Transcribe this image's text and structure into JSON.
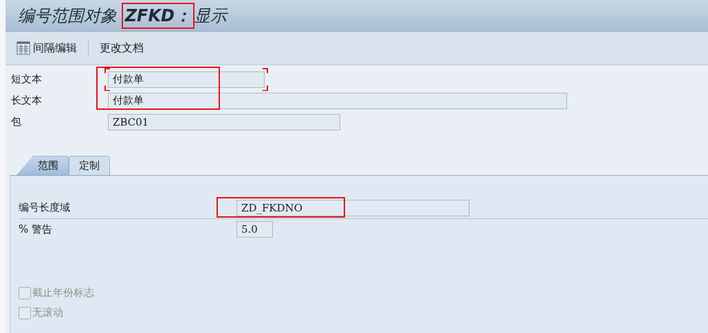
{
  "title": {
    "text": "编号范围对象 **ZFKD：**显示",
    "highlighted": true
  },
  "toolbar": [
    {
      "label": "间隔编辑",
      "kind": "icon"
    },
    {
      "label": "更改文档",
      "kind": "text"
    }
  ],
  "header_highlighted": true,
  "fields": [
    {
      "label": "短文本",
      "value": "付款单",
      "bracketed": true
    },
    {
      "label": "长文本",
      "value": "付款单",
      "bracketed": false
    },
    {
      "label": "包",
      "value": "ZBC01",
      "bracketed": false
    }
  ],
  "tabs": [
    {
      "label": "范围",
      "selected": true
    },
    {
      "label": "定制",
      "selected": false
    }
  ],
  "panel_fields": [
    {
      "label": "编号长度域",
      "value": "ZD_FKDNO",
      "highlighted": true
    },
    {
      "label": "% 警告",
      "value": "5.0",
      "highlighted": false
    }
  ],
  "checkboxes": [
    {
      "label": "截止年份标志",
      "checked": false,
      "disabled": true
    },
    {
      "label": "无滚动",
      "checked": false,
      "disabled": true
    }
  ]
}
